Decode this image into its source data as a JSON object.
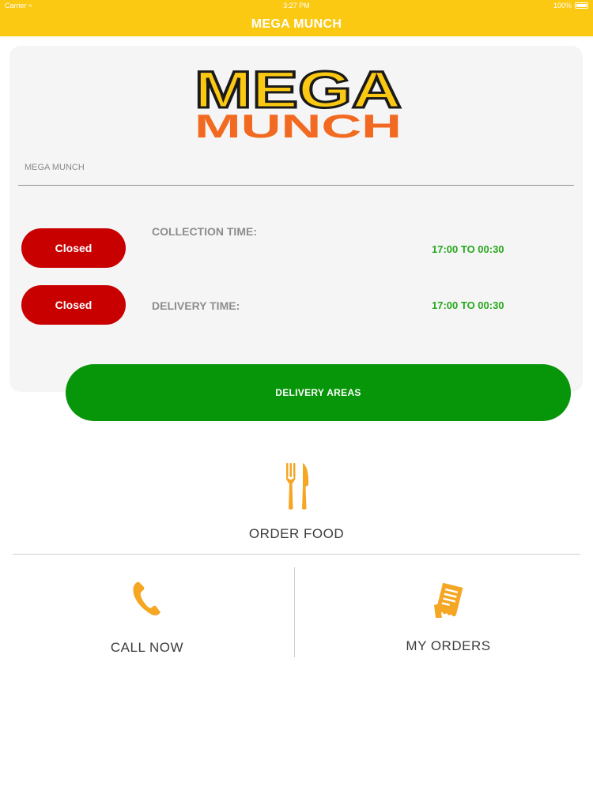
{
  "status_bar": {
    "carrier": "Carrier",
    "time": "3:27 PM",
    "battery": "100%"
  },
  "nav": {
    "title": "MEGA MUNCH"
  },
  "logo": {
    "line1": "MEGA",
    "line2": "MUNCH",
    "colors": {
      "mega_fill": "#fbc812",
      "mega_outline": "#1a1a1a",
      "munch_fill": "#f26a21"
    }
  },
  "store": {
    "name": "MEGA MUNCH"
  },
  "schedule": {
    "collection": {
      "status": "Closed",
      "label": "COLLECTION TIME:",
      "hours": "17:00 TO 00:30"
    },
    "delivery": {
      "status": "Closed",
      "label": "DELIVERY TIME:",
      "hours": "17:00 TO 00:30"
    }
  },
  "delivery_areas_button": "DELIVERY AREAS",
  "menu": {
    "order_food": {
      "label": "ORDER FOOD",
      "icon": "fork-knife-icon"
    },
    "call_now": {
      "label": "CALL NOW",
      "icon": "phone-icon"
    },
    "my_orders": {
      "label": "MY ORDERS",
      "icon": "receipt-icon"
    }
  },
  "colors": {
    "brand_yellow": "#fbc812",
    "closed_red": "#c90000",
    "hours_green": "#27a81c",
    "button_green": "#07950a",
    "icon_orange": "#f5a623"
  }
}
